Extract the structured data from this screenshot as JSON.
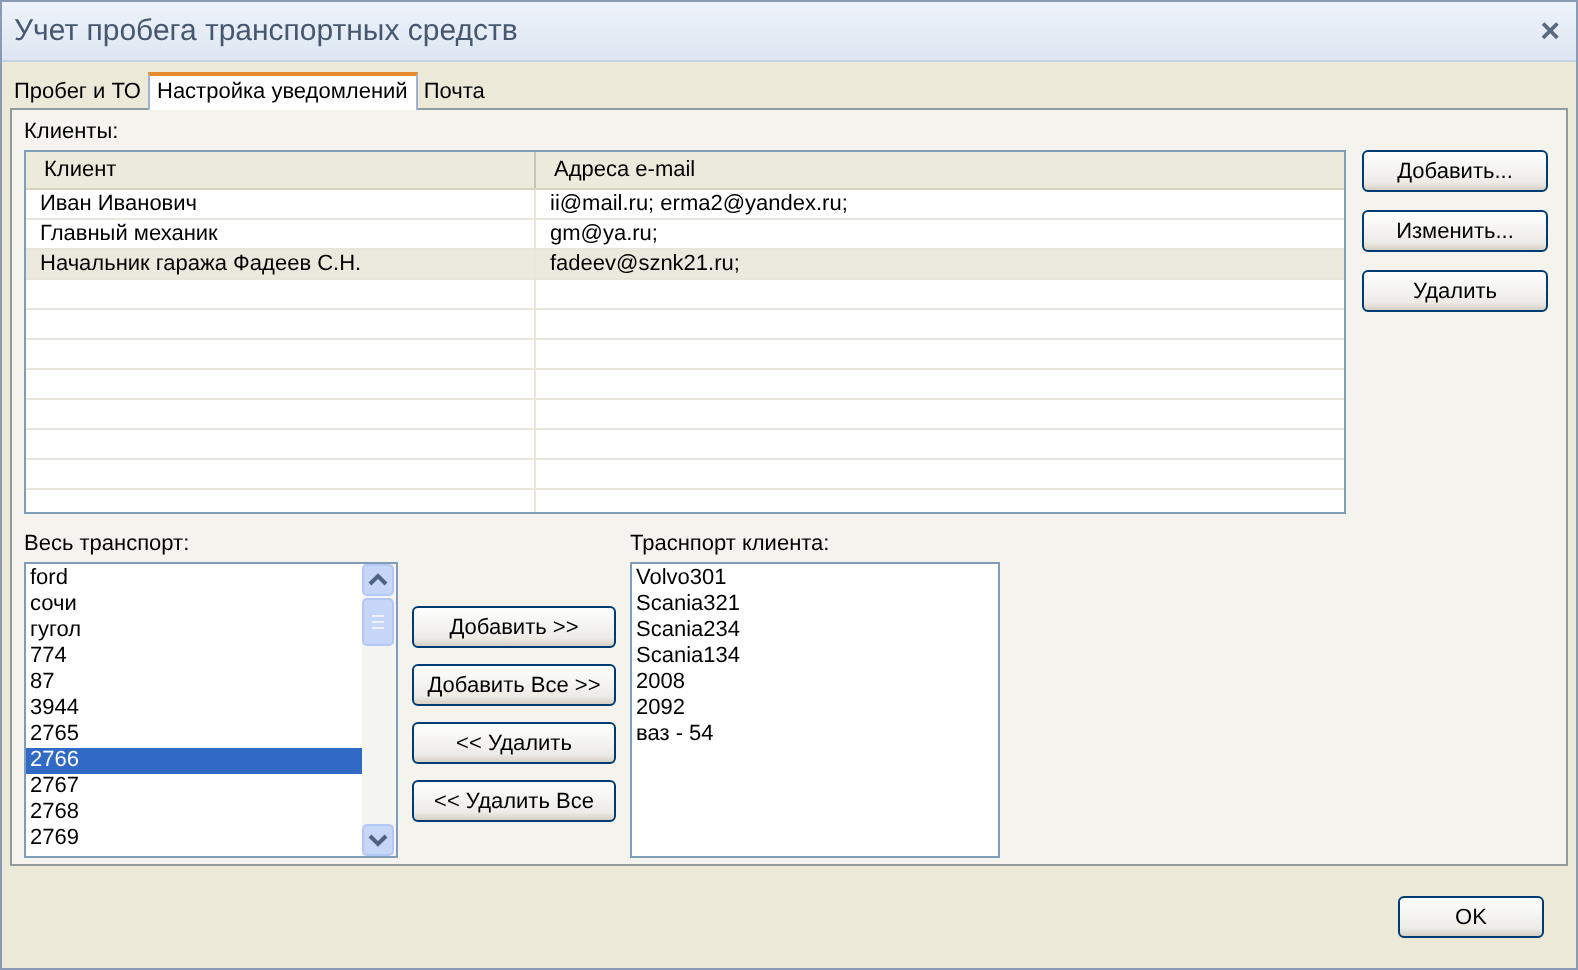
{
  "window": {
    "title": "Учет пробега транспортных средств",
    "close": "×"
  },
  "tabs": [
    {
      "label": "Пробег и ТО",
      "selected": false
    },
    {
      "label": "Настройка уведомлений",
      "selected": true
    },
    {
      "label": "Почта",
      "selected": false
    }
  ],
  "clients": {
    "label": "Клиенты:",
    "columns": [
      "Клиент",
      "Адреса e-mail"
    ],
    "rows": [
      {
        "cells": [
          "Иван Иванович",
          "ii@mail.ru; erma2@yandex.ru;"
        ],
        "selected": false
      },
      {
        "cells": [
          "Главный механик",
          "gm@ya.ru;"
        ],
        "selected": false
      },
      {
        "cells": [
          "Начальник гаража Фадеев С.Н.",
          "fadeev@sznk21.ru;"
        ],
        "selected": true
      }
    ],
    "buttons": [
      "Добавить...",
      "Изменить...",
      "Удалить"
    ]
  },
  "all_transport": {
    "label": "Весь транспорт:",
    "items": [
      {
        "text": "ford",
        "selected": false
      },
      {
        "text": "сочи",
        "selected": false
      },
      {
        "text": "гугол",
        "selected": false
      },
      {
        "text": "774",
        "selected": false
      },
      {
        "text": "87",
        "selected": false
      },
      {
        "text": "3944",
        "selected": false
      },
      {
        "text": "2765",
        "selected": false
      },
      {
        "text": "2766",
        "selected": true
      },
      {
        "text": "2767",
        "selected": false
      },
      {
        "text": "2768",
        "selected": false
      },
      {
        "text": "2769",
        "selected": false
      }
    ]
  },
  "transfer_buttons": [
    "Добавить >>",
    "Добавить Все >>",
    "<< Удалить",
    "<< Удалить Все"
  ],
  "client_transport": {
    "label": "Траснпорт клиента:",
    "items": [
      {
        "text": "Volvo301",
        "selected": false
      },
      {
        "text": "Scania321",
        "selected": false
      },
      {
        "text": "Scania234",
        "selected": false
      },
      {
        "text": "Scania134",
        "selected": false
      },
      {
        "text": "2008",
        "selected": false
      },
      {
        "text": "2092",
        "selected": false
      },
      {
        "text": "ваз - 54",
        "selected": false
      }
    ]
  },
  "ok_button": "OK"
}
